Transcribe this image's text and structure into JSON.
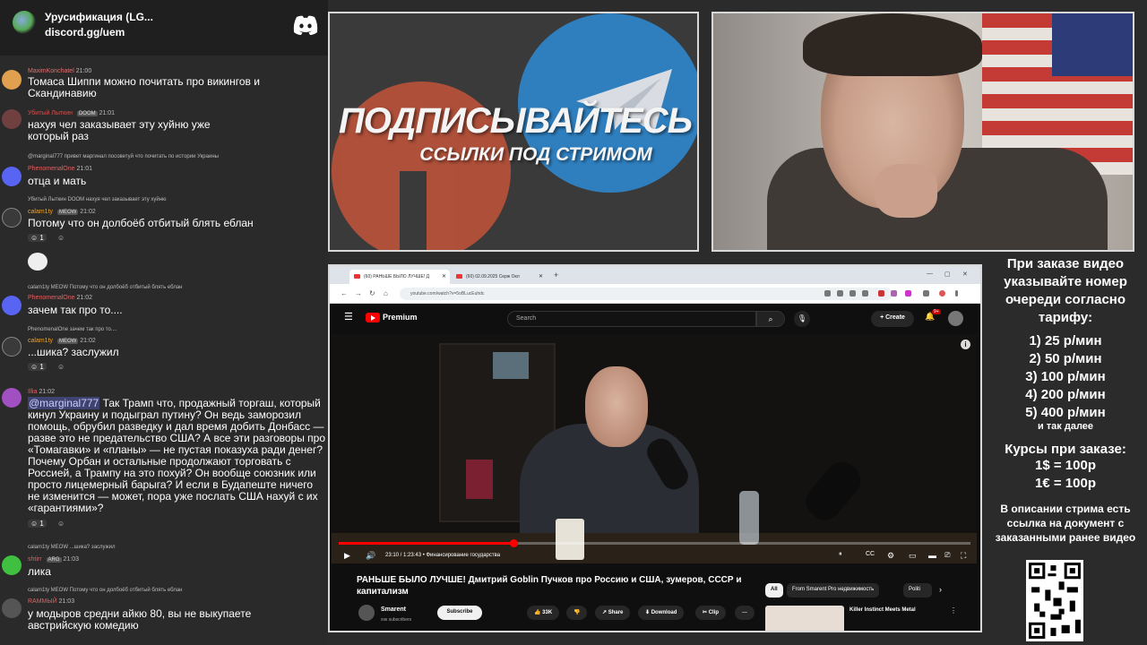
{
  "chat": {
    "server_name": "Урусификация (LG...",
    "server_link": "discord.gg/uem",
    "messages": [
      {
        "user": "MaximKonchatel",
        "time": "21:00",
        "text": "Томаса Шиппи можно почитать про викингов и Скандинавию",
        "user_color": "#e07070"
      },
      {
        "user": "Убитый Лыткин",
        "badge": "DOOM",
        "time": "21:01",
        "text": "нахуя чел заказывает эту хуйню уже который раз",
        "user_color": "#d05050"
      },
      {
        "reply": "@marginal777 привет маргинал посоветуй что почитать по истории Украины",
        "user": "PhenomenalOne",
        "time": "21:01",
        "text": "отца и мать",
        "user_color": "#e06060"
      },
      {
        "reply": "Убитый Лыткин DOOM нахуя чел заказывает эту хуйню",
        "user": "calam1ty",
        "badge": "MEOW",
        "time": "21:02",
        "text": "Потому что он долбоёб отбитый блять еблан",
        "user_color": "#f0a020",
        "reaction_count": "1"
      },
      {
        "reply": "calam1ty MEOW Потому что он долбоёб отбитый блять еблан",
        "user": "PhenomenalOne",
        "time": "21:02",
        "text": "зачем так про то....",
        "user_color": "#e06060"
      },
      {
        "reply": "PhenomenalOne зачем так про то....",
        "user": "calam1ty",
        "badge": "MEOW",
        "time": "21:02",
        "text": "...шика? заслужил",
        "user_color": "#f0a020",
        "reaction_count": "1"
      },
      {
        "user": "Illia",
        "time": "21:02",
        "mention": "@marginal777",
        "text": "Так Трамп что, продажный торгаш, который кинул Украину и подыграл путину? Он ведь заморозил помощь, обрубил разведку и дал время добить Донбасс — разве это не предательство США? А все эти разговоры про «Томагавки» и «планы» — не пустая показуха ради денег? Почему Орбан и остальные продолжают торговать с Россией, а Трампу на это похуй? Он вообще союзник или просто лицемерный барыга? И если в Будапеште ничего не изменится — может, пора уже послать США нахуй с их «гарантиями»?",
        "user_color": "#e06060",
        "reaction_count": "1"
      },
      {
        "reply": "calam1ty MEOW ...шика? заслужил",
        "user": "shtirr",
        "badge": "ARG",
        "time": "21:03",
        "text": "лика",
        "user_color": "#e06060"
      },
      {
        "reply": "calam1ty MEOW Потому что он долбоёб отбитый блять еблан",
        "user": "RAMMЫЙ",
        "time": "21:03",
        "text": "у модыров средни айкю 80, вы не выкупаете австрийскую комедию",
        "user_color": "#e06060"
      }
    ]
  },
  "promo": {
    "title": "ПОДПИСЫВАЙТЕСЬ",
    "subtitle": "ССЫЛКИ ПОД СТРИМОМ"
  },
  "browser": {
    "tabs": [
      "(60) РАНЬШЕ БЫЛО ЛУЧШЕ! Д",
      "(60) 02.09.2025 Серж Окл"
    ],
    "url": "youtube.com/watch?v=5oBLucEuhdc",
    "yt": {
      "premium": "Premium",
      "search_placeholder": "Search",
      "create": "Create",
      "notif_count": "9+",
      "time": "23:10 / 1:23:43",
      "chapter": "• Финансирование государства",
      "video_title": "РАНЬШЕ БЫЛО ЛУЧШЕ! Дмитрий Goblin Пучков про Россию и США, зумеров, СССР и капитализм",
      "channel": "Smarent",
      "subscribers": "ххк subscribers",
      "subscribe": "Subscribe",
      "likes": "33K",
      "share": "Share",
      "download": "Download",
      "clip": "Clip",
      "chips": [
        "All",
        "From Smarent Pro недвижимость",
        "Politi"
      ],
      "rec_title": "Killer Instinct Meets Metal"
    }
  },
  "info": {
    "header": [
      "При заказе видео",
      "указывайте номер",
      "очереди согласно",
      "тарифу:"
    ],
    "prices": [
      "1) 25 р/мин",
      "2) 50 р/мин",
      "3) 100 р/мин",
      "4) 200 р/мин",
      "5) 400 р/мин"
    ],
    "etc": "и так далее",
    "rates_head": "Курсы при заказе:",
    "rates": [
      "1$ = 100р",
      "1€ = 100р"
    ],
    "desc": "В описании стрима есть ссылка на документ с заказанными ранее видео"
  },
  "colors": {
    "discord": "#5865f2",
    "youtube_red": "#ff0000",
    "telegram": "#2f7fbf",
    "patreon": "#c3543a"
  }
}
